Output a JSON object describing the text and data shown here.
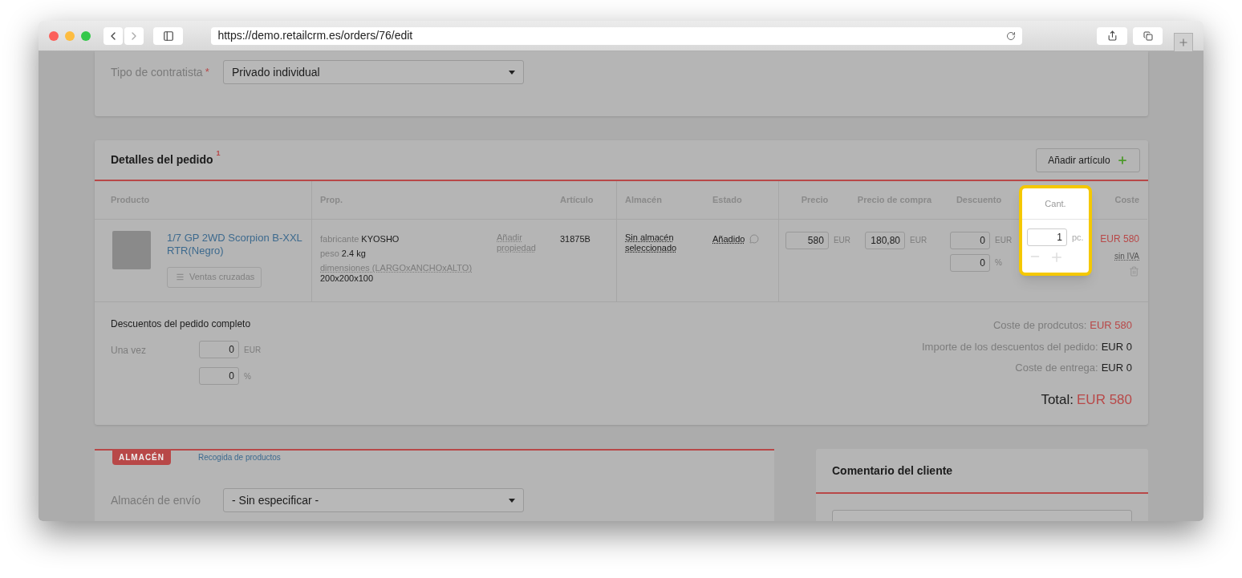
{
  "browser": {
    "url": "https://demo.retailcrm.es/orders/76/edit"
  },
  "contractor": {
    "label": "Tipo de contratista",
    "required_mark": "*",
    "value": "Privado individual"
  },
  "order_details": {
    "title": "Detalles del pedido",
    "title_mark": "1",
    "add_button": "Añadir artículo",
    "columns": [
      {
        "label": "Producto",
        "highlighted": false
      },
      {
        "label": "Prop.",
        "highlighted": false
      },
      {
        "label": "Artículo",
        "highlighted": false
      },
      {
        "label": "Almacén",
        "highlighted": false
      },
      {
        "label": "Estado",
        "highlighted": false
      },
      {
        "label": "Precio",
        "highlighted": false
      },
      {
        "label": "Precio de compra",
        "highlighted": false
      },
      {
        "label": "Descuento",
        "highlighted": false
      },
      {
        "label": "Cant.",
        "highlighted": true
      },
      {
        "label": "Coste",
        "highlighted": false
      }
    ],
    "item": {
      "name": "1/7 GP 2WD Scorpion B-XXL RTR(Negro)",
      "cross_sell_button": "Ventas cruzadas",
      "properties": [
        {
          "kind": "inline",
          "name": "fabricante",
          "value": "KYOSHO"
        },
        {
          "kind": "inline",
          "name": "peso",
          "value": "2.4 kg"
        },
        {
          "kind": "block",
          "name": "dimensiones (LARGOxANCHOxALTO)",
          "value": "200x200x100"
        }
      ],
      "add_property": "Añadir propiedad",
      "article": "31875B",
      "warehouse": "Sin almacén seleccionado",
      "status": "Añadido",
      "price": {
        "value": "580",
        "unit": "EUR"
      },
      "purchase_price": {
        "value": "180,80",
        "unit": "EUR"
      },
      "discounts": [
        {
          "value": "0",
          "unit": "EUR"
        },
        {
          "value": "0",
          "unit": "%"
        }
      ],
      "quantity": {
        "value": "1",
        "unit": "pc."
      },
      "cost": "EUR 580",
      "tax": "sin IVA"
    },
    "order_discounts": {
      "title": "Descuentos del pedido completo",
      "label": "Una vez",
      "fields": [
        {
          "value": "0",
          "unit": "EUR"
        },
        {
          "value": "0",
          "unit": "%"
        }
      ]
    },
    "totals": [
      {
        "label": "Coste de prodcutos:",
        "value": "EUR 580",
        "highlight": true
      },
      {
        "label": "Importe de los descuentos del pedido:",
        "value": "EUR 0",
        "highlight": false
      },
      {
        "label": "Coste de entrega:",
        "value": "EUR 0",
        "highlight": false
      }
    ],
    "total": {
      "label": "Total:",
      "value": "EUR 580"
    }
  },
  "warehouse_section": {
    "tabs": [
      {
        "label": "ALMACÉN",
        "selected": true
      },
      {
        "label": "Recogida de productos",
        "selected": false
      }
    ],
    "field_label": "Almacén de envío",
    "field_value": "- Sin especificar -"
  },
  "customer_comment": {
    "title": "Comentario del cliente"
  }
}
